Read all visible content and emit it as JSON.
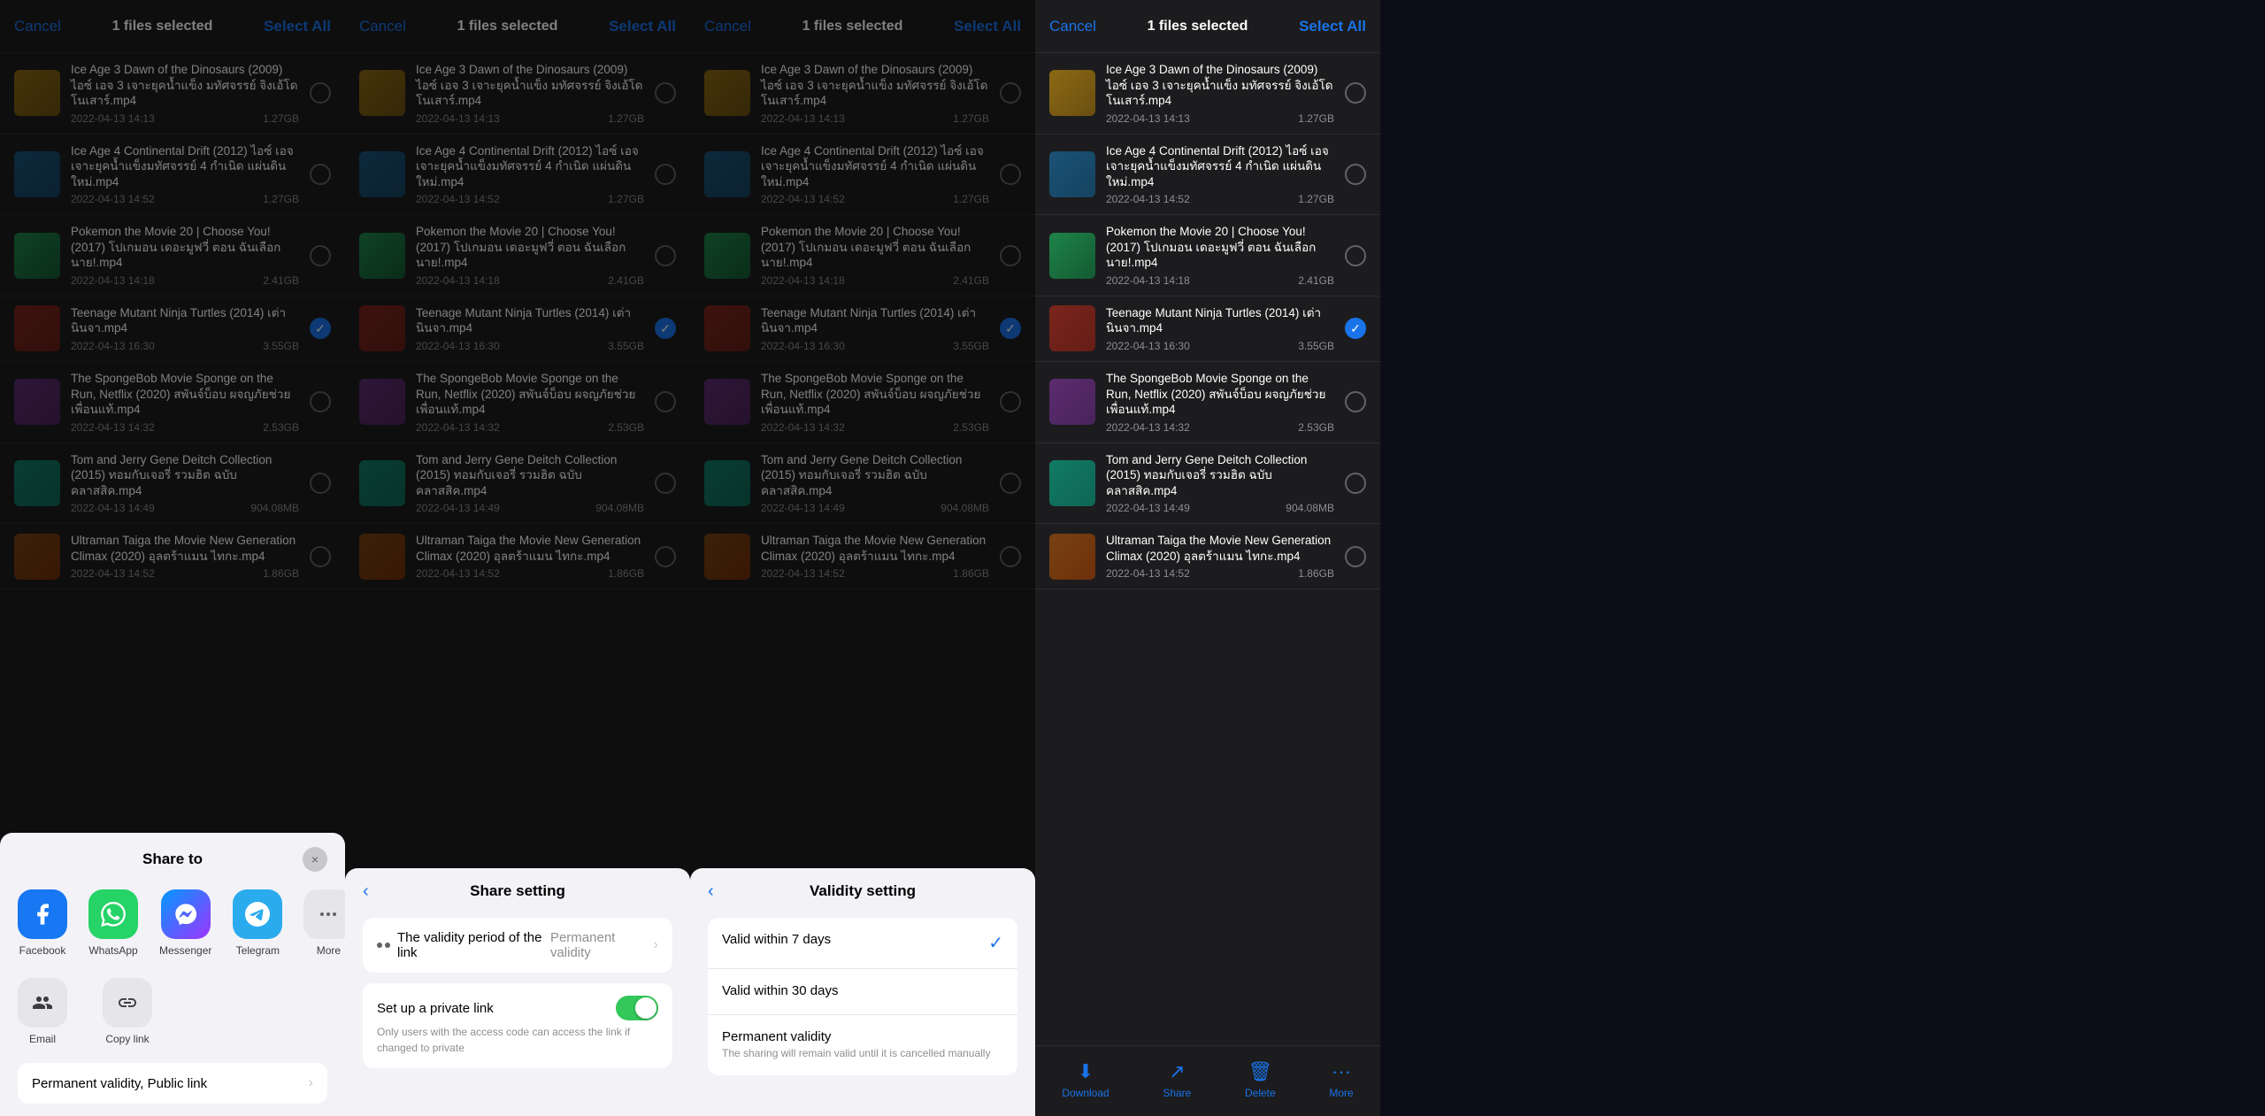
{
  "panels": [
    {
      "id": "panel-1",
      "topbar": {
        "cancel": "Cancel",
        "title": "1 files selected",
        "selectAll": "Select All"
      },
      "files": [
        {
          "name": "Ice Age 3 Dawn of the Dinosaurs (2009) ไอซ์ เอจ 3 เจาะยุคน้ำแข็ง มทัศจรรย์ จิงเอ้โด โนเสาร์.mp4",
          "date": "2022-04-13 14:13",
          "size": "1.27GB",
          "checked": false,
          "thumbClass": "thumb-1"
        },
        {
          "name": "Ice Age 4 Continental Drift (2012) ไอซ์ เอจ เจาะยุคน้ำแข็งมทัศจรรย์ 4 กำเนิด แผ่นดินใหม่.mp4",
          "date": "2022-04-13 14:52",
          "size": "1.27GB",
          "checked": false,
          "thumbClass": "thumb-2"
        },
        {
          "name": "Pokemon the Movie 20 | Choose You! (2017) โปเกมอน เดอะมูฟวี่ ตอน ฉันเลือกนาย!.mp4",
          "date": "2022-04-13 14:18",
          "size": "2.41GB",
          "checked": false,
          "thumbClass": "thumb-3"
        },
        {
          "name": "Teenage Mutant Ninja Turtles (2014) เต่านินจา.mp4",
          "date": "2022-04-13 16:30",
          "size": "3.55GB",
          "checked": true,
          "thumbClass": "thumb-4"
        },
        {
          "name": "The SpongeBob Movie Sponge on the Run, Netflix (2020) สพันจ์บ็อบ ผจญภัยช่วยเพื่อนแท้.mp4",
          "date": "2022-04-13 14:32",
          "size": "2.53GB",
          "checked": false,
          "thumbClass": "thumb-5"
        },
        {
          "name": "Tom and Jerry Gene Deitch Collection (2015) ทอมกับเจอรี่ รวมฮิต ฉบับคลาสสิค.mp4",
          "date": "2022-04-13 14:49",
          "size": "904.08MB",
          "checked": false,
          "thumbClass": "thumb-6"
        },
        {
          "name": "Ultraman Taiga the Movie New Generation Climax (2020) อุลตร้าแมน ไทกะ.mp4",
          "date": "2022-04-13 14:52",
          "size": "1.86GB",
          "checked": false,
          "thumbClass": "thumb-7"
        }
      ],
      "toolbar": {
        "download": "Download",
        "share": "Share",
        "delete": "Delete",
        "more": "More"
      }
    }
  ],
  "shareTo": {
    "title": "Share to",
    "closeIcon": "×",
    "apps": [
      {
        "name": "Facebook",
        "icon": "f",
        "colorClass": "icon-facebook"
      },
      {
        "name": "WhatsApp",
        "icon": "W",
        "colorClass": "icon-whatsapp"
      },
      {
        "name": "Messenger",
        "icon": "m",
        "colorClass": "icon-messenger"
      },
      {
        "name": "Telegram",
        "icon": "✈",
        "colorClass": "icon-telegram"
      },
      {
        "name": "More",
        "icon": "···",
        "colorClass": "icon-more"
      }
    ],
    "utils": [
      {
        "name": "Email",
        "icon": "👤+"
      },
      {
        "name": "Copy link",
        "icon": "🔗"
      }
    ],
    "validityRow": "Permanent validity, Public link",
    "validityChevron": "›"
  },
  "shareSetting": {
    "title": "Share setting",
    "backIcon": "‹",
    "validityLabel": "The validity period of the link",
    "validityValue": "Permanent validity",
    "chevron": "›",
    "privateLinkTitle": "Set up a private link",
    "privateLinkDesc": "Only users with the access code can access the link if changed to private"
  },
  "validitySetting": {
    "title": "Validity setting",
    "backIcon": "‹",
    "options": [
      {
        "title": "Valid within 7 days",
        "desc": "",
        "selected": true
      },
      {
        "title": "Valid within 30 days",
        "desc": "",
        "selected": false
      },
      {
        "title": "Permanent validity",
        "desc": "The sharing will remain valid until it is cancelled manually",
        "selected": false
      }
    ]
  }
}
